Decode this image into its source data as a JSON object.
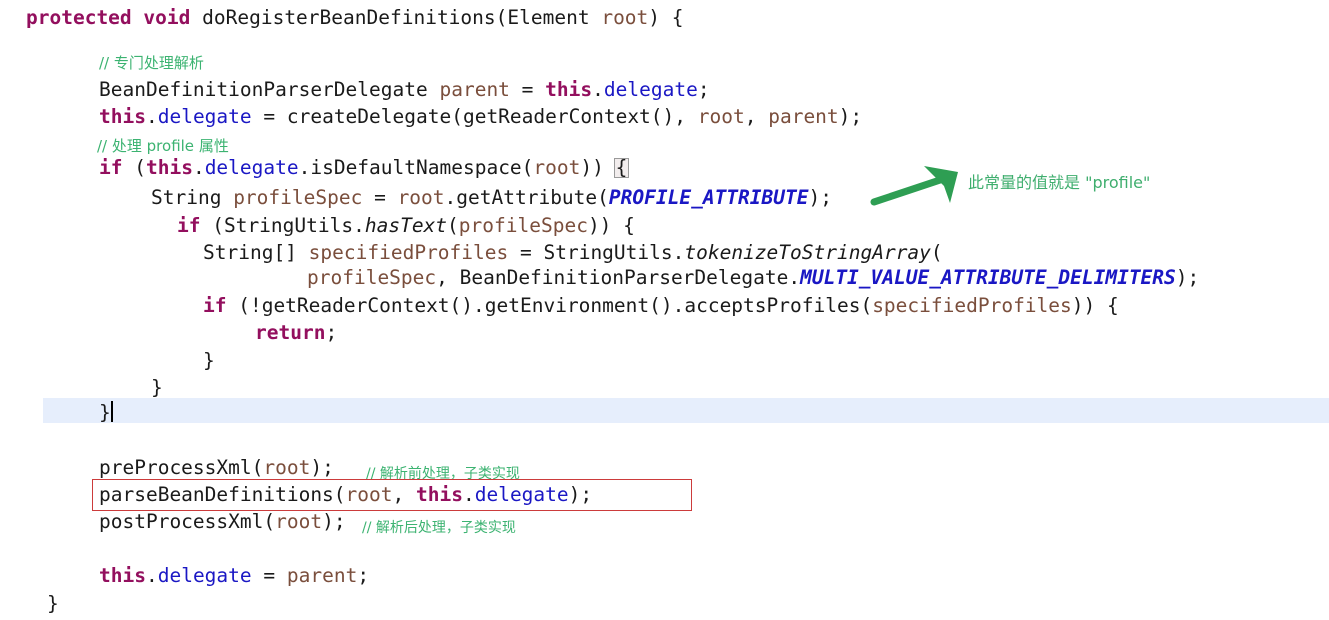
{
  "app": {
    "kind": "code-editor",
    "language": "java",
    "theme": "light"
  },
  "colors": {
    "background": "#ffffff",
    "keyword": "#930f5e",
    "field": "#1a17c4",
    "constant": "#1a17c4",
    "parameter": "#7a4e3c",
    "comment": "#3cb371",
    "plain": "#1a1a1a",
    "current_line_highlight": "#e6eefc",
    "callout_box": "#cc3b3b",
    "annotation_arrow": "#2e9e53",
    "annotation_text": "#3fae6e",
    "brace_match_bg": "#f2eded"
  },
  "code": {
    "signature": {
      "kw_protected": "protected",
      "kw_void": "void",
      "method_name": "doRegisterBeanDefinitions",
      "param_type": "Element",
      "param_name": "root",
      "open_brace": ") {",
      "open_paren": "("
    },
    "comments": {
      "c1": "// 专门处理解析",
      "c2_a": "// 处理 ",
      "c2_b": "profile",
      "c2_c": " 属性",
      "c3": "// 解析前处理，子类实现",
      "c4": "// 解析后处理，子类实现"
    },
    "lines": {
      "l3_type": "BeanDefinitionParserDelegate",
      "l3_var": "parent",
      "l3_eq": " = ",
      "l3_this": "this",
      "l3_dot": ".",
      "l3_field": "delegate",
      "l3_semi": ";",
      "l4_this": "this",
      "l4_field": "delegate",
      "l4_assign": " = createDelegate(getReaderContext(), ",
      "l4_root": "root",
      "l4_comma": ", ",
      "l4_parent": "parent",
      "l4_end": ");",
      "l6_if": "if",
      "l6_p1": " (",
      "l6_this": "this",
      "l6_mid": ".delegate.isDefaultNamespace(",
      "l6_field": "delegate",
      "l6_call": ".isDefaultNamespace(",
      "l6_root": "root",
      "l6_close": ")) ",
      "l6_brace": "{",
      "l7_type": "String ",
      "l7_var": "profileSpec",
      "l7_eq": " = ",
      "l7_root": "root",
      "l7_call": ".getAttribute(",
      "l7_const": "PROFILE_ATTRIBUTE",
      "l7_end": ");",
      "l8_if": "if",
      "l8_p": " (StringUtils.",
      "l8_mth": "hasText",
      "l8_op": "(",
      "l8_var": "profileSpec",
      "l8_end": ")) {",
      "l9_type": "String[] ",
      "l9_var": "specifiedProfiles",
      "l9_eq": " = StringUtils.",
      "l9_mth": "tokenizeToStringArray",
      "l9_open": "(",
      "l10_var": "profileSpec",
      "l10_mid": ", BeanDefinitionParserDelegate.",
      "l10_const": "MULTI_VALUE_ATTRIBUTE_DELIMITERS",
      "l10_end": ");",
      "l11_if": "if",
      "l11_body": " (!getReaderContext().getEnvironment().acceptsProfiles(",
      "l11_var": "specifiedProfiles",
      "l11_end": ")) {",
      "l12_return": "return",
      "l12_semi": ";",
      "l13_brace": "}",
      "l14_brace": "}",
      "l15_brace": "}",
      "l17_pre": "preProcessXml(",
      "l17_root": "root",
      "l17_end": ");",
      "l18_parse": "parseBeanDefinitions(",
      "l18_root": "root",
      "l18_comma": ", ",
      "l18_this": "this",
      "l18_dot": ".",
      "l18_field": "delegate",
      "l18_end": ");",
      "l19_post": "postProcessXml(",
      "l19_root": "root",
      "l19_end": ");",
      "l21_this": "this",
      "l21_dot": ".",
      "l21_field": "delegate",
      "l21_eq": " = ",
      "l21_parent": "parent",
      "l21_semi": ";",
      "l22_brace": "}"
    }
  },
  "annotations": {
    "arrow_note": "此常量的值就是 \"profile\"",
    "highlight_box_target": "parseBeanDefinitions(root, this.delegate);"
  }
}
